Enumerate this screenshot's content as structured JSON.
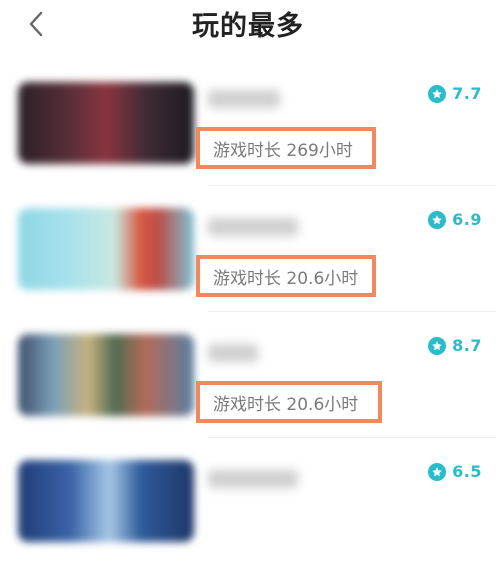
{
  "header": {
    "title": "玩的最多",
    "back_icon": "chevron-left-icon"
  },
  "colors": {
    "accent": "#2bbccb",
    "highlight_border": "#f08a5e",
    "text_muted": "#7a7a7a"
  },
  "games": [
    {
      "rating": "7.7",
      "playtime": "游戏时长 269小时"
    },
    {
      "rating": "6.9",
      "playtime": "游戏时长 20.6小时"
    },
    {
      "rating": "8.7",
      "playtime": "游戏时长 20.6小时"
    },
    {
      "rating": "6.5",
      "playtime": ""
    }
  ]
}
